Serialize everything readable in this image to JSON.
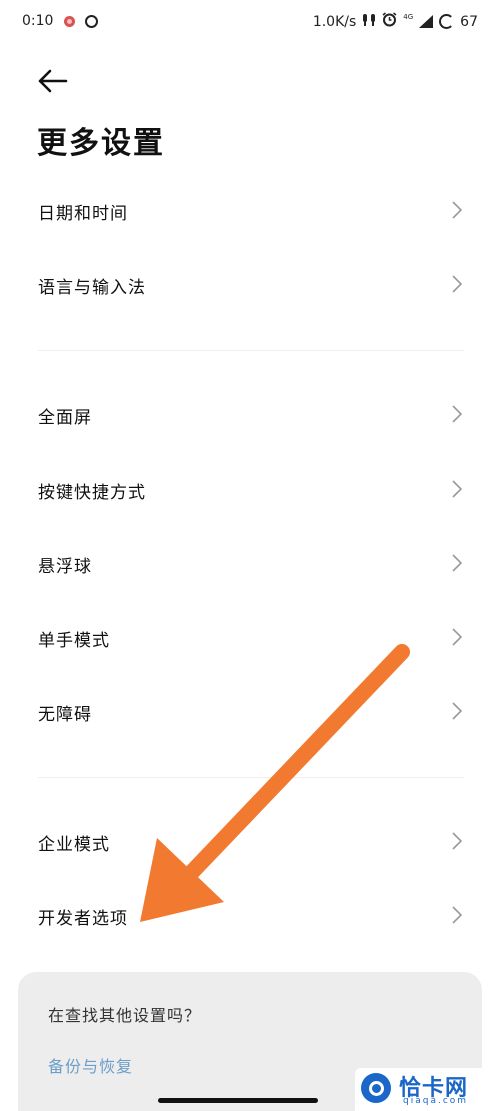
{
  "status_bar": {
    "time": "0:10",
    "net_speed": "1.0K/s",
    "net_type": "4G",
    "battery": "67",
    "icons": [
      "notification-icon",
      "circle-notification-icon",
      "bluetooth-headset-icon",
      "alarm-icon",
      "signal-icon",
      "battery-icon"
    ]
  },
  "header": {
    "back_icon": "arrow-left-icon",
    "title": "更多设置"
  },
  "sections": [
    {
      "items": [
        {
          "label": "日期和时间"
        },
        {
          "label": "语言与输入法"
        }
      ]
    },
    {
      "items": [
        {
          "label": "全面屏"
        },
        {
          "label": "按键快捷方式"
        },
        {
          "label": "悬浮球"
        },
        {
          "label": "单手模式"
        },
        {
          "label": "无障碍"
        }
      ]
    },
    {
      "items": [
        {
          "label": "企业模式"
        },
        {
          "label": "开发者选项"
        }
      ]
    }
  ],
  "search_card": {
    "question": "在查找其他设置吗？",
    "link": "备份与恢复"
  },
  "watermark": {
    "brand": "恰卡网",
    "domain": "qiaqa.com"
  },
  "colors": {
    "background": "#ffffff",
    "card": "#ededed",
    "link": "#6b9ec8",
    "annotation_arrow": "#f27a30",
    "watermark": "#1a66c9"
  }
}
